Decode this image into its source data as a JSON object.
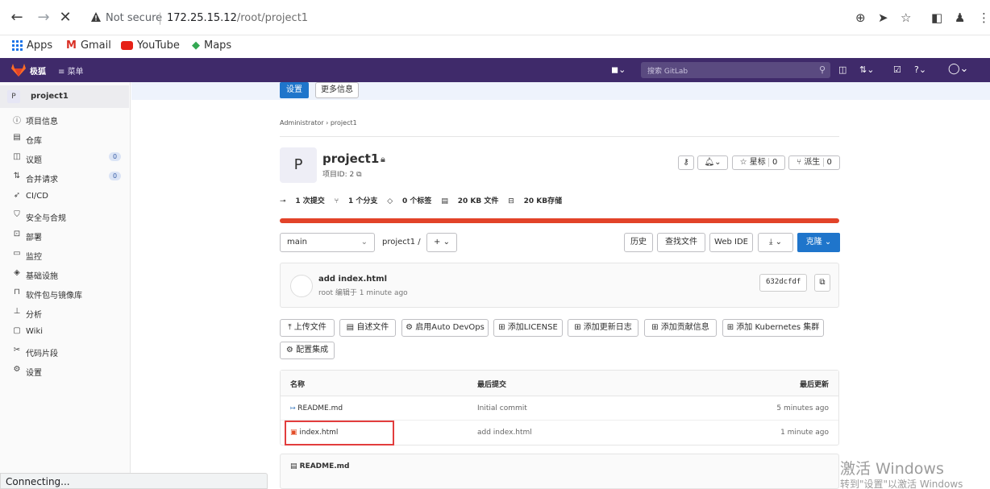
{
  "browser": {
    "security": "Not secure",
    "url_host": "172.25.15.12",
    "url_path": "/root/project1",
    "bookmarks": [
      "Apps",
      "Gmail",
      "YouTube",
      "Maps"
    ]
  },
  "gitlab_nav": {
    "brand": "极狐",
    "brand_sub": "GitLab",
    "menu_label": "菜单",
    "search_placeholder": "搜索 GitLab"
  },
  "sidebar": {
    "project_avatar": "P",
    "project_name": "project1",
    "items": [
      {
        "icon": "info-icon",
        "glyph": "ⓘ",
        "label": "项目信息"
      },
      {
        "icon": "repository-icon",
        "glyph": "▤",
        "label": "仓库"
      },
      {
        "icon": "issues-icon",
        "glyph": "◫",
        "label": "议题",
        "count": "0"
      },
      {
        "icon": "merge-request-icon",
        "glyph": "⇅",
        "label": "合并请求",
        "count": "0"
      },
      {
        "icon": "rocket-icon",
        "glyph": "➶",
        "label": "CI/CD"
      },
      {
        "icon": "shield-icon",
        "glyph": "⛉",
        "label": "安全与合规"
      },
      {
        "icon": "deployments-icon",
        "glyph": "⊡",
        "label": "部署"
      },
      {
        "icon": "monitor-icon",
        "glyph": "▭",
        "label": "监控"
      },
      {
        "icon": "infrastructure-icon",
        "glyph": "◈",
        "label": "基础设施"
      },
      {
        "icon": "package-icon",
        "glyph": "⊓",
        "label": "软件包与镜像库"
      },
      {
        "icon": "analytics-icon",
        "glyph": "⊥",
        "label": "分析"
      },
      {
        "icon": "wiki-icon",
        "glyph": "▢",
        "label": "Wiki"
      },
      {
        "icon": "snippets-icon",
        "glyph": "✂",
        "label": "代码片段"
      },
      {
        "icon": "settings-icon",
        "glyph": "⚙",
        "label": "设置"
      }
    ],
    "status": "Connecting..."
  },
  "top_tabs": {
    "settings": "设置",
    "more_info": "更多信息"
  },
  "breadcrumb": {
    "parent": "Administrator",
    "sep": "›",
    "current": "project1"
  },
  "project": {
    "avatar": "P",
    "title": "project1",
    "id_label": "项目ID: 2",
    "star_label": "星标",
    "star_count": "0",
    "fork_label": "派生",
    "fork_count": "0"
  },
  "stats": {
    "commits": "1 次提交",
    "branches": "1 个分支",
    "tags": "0 个标签",
    "files": "20 KB 文件",
    "storage": "20 KB存储"
  },
  "toolbar": {
    "branch": "main",
    "path": "project1",
    "path_sep": "/",
    "add": "+",
    "history": "历史",
    "find_file": "查找文件",
    "web_ide": "Web IDE",
    "download": "⤓",
    "clone": "克隆"
  },
  "last_commit": {
    "title": "add index.html",
    "meta": "root 编辑于 1 minute ago",
    "sha": "632dcfdf"
  },
  "actions": {
    "upload": "上传文件",
    "readme": "自述文件",
    "auto_devops": "启用Auto DevOps",
    "license": "添加LICENSE",
    "changelog": "添加更新日志",
    "contributing": "添加贡献信息",
    "kubernetes": "添加 Kubernetes 集群",
    "integrations": "配置集成"
  },
  "files": {
    "headers": {
      "name": "名称",
      "last_commit": "最后提交",
      "last_update": "最后更新"
    },
    "rows": [
      {
        "name": "README.md",
        "commit": "Initial commit",
        "updated": "5 minutes ago"
      },
      {
        "name": "index.html",
        "commit": "add index.html",
        "updated": "1 minute ago"
      }
    ]
  },
  "readme": {
    "title": "README.md"
  },
  "watermark": {
    "line1": "激活 Windows",
    "line2": "转到\"设置\"以激活 Windows"
  }
}
